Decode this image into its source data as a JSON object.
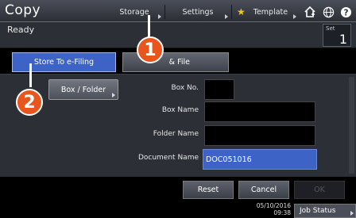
{
  "header": {
    "app_title": "Copy",
    "storage_label": "Storage",
    "settings_label": "Settings",
    "template_label": "Template"
  },
  "status": {
    "message": "Ready",
    "set_label": "Set",
    "set_value": "1"
  },
  "tabs": [
    {
      "label": "Store To e-Filing",
      "active": true
    },
    {
      "label": "& File",
      "active": false
    }
  ],
  "form": {
    "box_button_label": "Box / Folder",
    "box_no_label": "Box No.",
    "box_no_value": "",
    "box_name_label": "Box Name",
    "box_name_value": "",
    "folder_name_label": "Folder Name",
    "folder_name_value": "",
    "document_name_label": "Document Name",
    "document_name_value": "DOC051016"
  },
  "actions": {
    "reset_label": "Reset",
    "cancel_label": "Cancel",
    "ok_label": "OK"
  },
  "footer": {
    "date": "05/10/2016",
    "time": "09:38",
    "job_status_label": "Job Status"
  },
  "callouts": {
    "one": "1",
    "two": "2"
  },
  "colors": {
    "accent": "#3d63c7",
    "callout": "#e8561d"
  }
}
